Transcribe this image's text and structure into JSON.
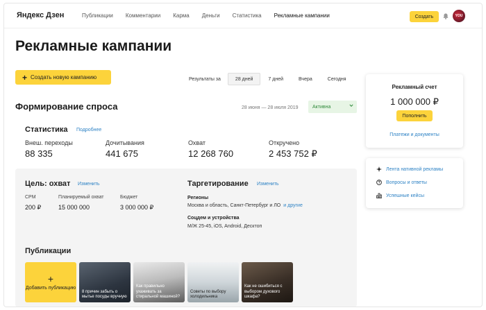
{
  "header": {
    "logo": "Яндекс Дзен",
    "nav": [
      "Публикации",
      "Комментарии",
      "Карма",
      "Деньги",
      "Статистика",
      "Рекламные кампании"
    ],
    "create_label": "Создать",
    "avatar_text": "YOU"
  },
  "page": {
    "title": "Рекламные кампании",
    "new_campaign_label": "Создать новую кампанию"
  },
  "period": {
    "label": "Результаты за",
    "options": [
      "28 дней",
      "7 дней",
      "Вчера",
      "Сегодня"
    ],
    "selected": "28 дней"
  },
  "campaign": {
    "title": "Формирование спроса",
    "date_range": "28 июня — 28 июля 2019",
    "status": "Активна"
  },
  "stats": {
    "title": "Статистика",
    "more_link": "Подробнее",
    "metrics": [
      {
        "label": "Внеш. переходы",
        "value": "88 335"
      },
      {
        "label": "Дочитывания",
        "value": "441 675"
      },
      {
        "label": "Охват",
        "value": "12 268 760"
      },
      {
        "label": "Откручено",
        "value": "2 453 752 ₽"
      }
    ]
  },
  "goal": {
    "title": "Цель: охват",
    "edit": "Изменить",
    "metrics": [
      {
        "label": "CPM",
        "value": "200 ₽"
      },
      {
        "label": "Планируемый охват",
        "value": "15 000 000"
      },
      {
        "label": "Бюджет",
        "value": "3 000 000 ₽"
      }
    ]
  },
  "targeting": {
    "title": "Таргетирование",
    "edit": "Изменить",
    "regions_label": "Регионы",
    "regions_value": "Москва и область, Санкт-Петербург и ЛО",
    "regions_more": "и другие",
    "socdem_label": "Соцдем и устройства",
    "socdem_value": "М/Ж 25-45, iOS, Android, Десктоп"
  },
  "publications": {
    "title": "Публикации",
    "add_label": "Добавить публикацию",
    "items": [
      {
        "caption": "8 причин забыть о мытье посуды вручную"
      },
      {
        "caption": "Как правильно ухаживать за стиральной машиной?"
      },
      {
        "caption": "Советы по выбору холодильника"
      },
      {
        "caption": "Как не ошибиться с выбором духового шкафа?"
      }
    ]
  },
  "account": {
    "title": "Рекламный счет",
    "amount": "1 000 000 ₽",
    "topup_label": "Пополнить",
    "payments_link": "Платежи и документы"
  },
  "links": [
    {
      "label": "Лента нативной рекламы",
      "icon": "sparkle-icon"
    },
    {
      "label": "Вопросы и ответы",
      "icon": "question-icon"
    },
    {
      "label": "Успешные кейсы",
      "icon": "chart-icon"
    }
  ],
  "colors": {
    "accent_yellow": "#fcd33b",
    "link_blue": "#2f83c5",
    "status_green": "#2f8a3a",
    "logo_red": "#e5262b"
  }
}
